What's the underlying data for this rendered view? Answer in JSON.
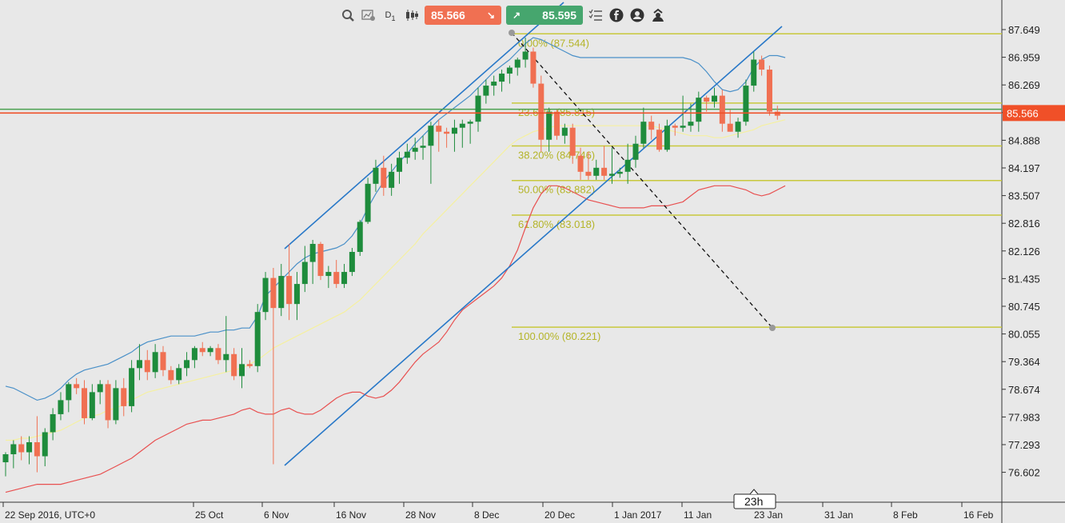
{
  "toolbar": {
    "timeframe": "D",
    "timeframe_sub": "1",
    "sell_price": "85.566",
    "buy_price": "85.595",
    "sell_color": "#f07052",
    "buy_color": "#46a66e",
    "icons": [
      "zoom-icon",
      "chart-settings-icon",
      "timeframe-icon",
      "candles-icon",
      "sell-arrow-icon",
      "buy-arrow-icon",
      "list-icon",
      "facebook-icon",
      "profile-icon",
      "user-icon"
    ]
  },
  "badge": {
    "time_left": "23h"
  },
  "chart_data": {
    "type": "candlestick",
    "instrument_price_now": 85.566,
    "ylim": [
      76.3,
      88.0
    ],
    "y_ticks": [
      "87.649",
      "86.959",
      "86.269",
      "85.566",
      "84.888",
      "84.197",
      "83.507",
      "82.816",
      "82.126",
      "81.435",
      "80.745",
      "80.055",
      "79.364",
      "78.674",
      "77.983",
      "77.293",
      "76.602"
    ],
    "x_ticks": [
      "22 Sep 2016, UTC+0",
      "25 Oct",
      "6 Nov",
      "16 Nov",
      "28 Nov",
      "8 Dec",
      "20 Dec",
      "1 Jan 2017",
      "11 Jan",
      "23 Jan",
      "31 Jan",
      "8 Feb",
      "16 Feb"
    ],
    "colors": {
      "up": "#1e8c3c",
      "down": "#f07052",
      "upper_band": "#4a90c8",
      "middle_band": "#f5f0a0",
      "lower_band": "#e85050",
      "trend": "#2878c8",
      "fib": "#c8c83c",
      "price_line": "#f05028",
      "hline": "#4aa050"
    },
    "candles": [
      {
        "o": 76.85,
        "h": 77.1,
        "l": 76.5,
        "c": 77.05
      },
      {
        "o": 77.05,
        "h": 77.4,
        "l": 76.7,
        "c": 77.3
      },
      {
        "o": 77.3,
        "h": 77.5,
        "l": 76.9,
        "c": 77.1
      },
      {
        "o": 77.1,
        "h": 77.5,
        "l": 76.8,
        "c": 77.35
      },
      {
        "o": 77.35,
        "h": 78.0,
        "l": 76.6,
        "c": 77.0
      },
      {
        "o": 77.0,
        "h": 77.7,
        "l": 76.75,
        "c": 77.6
      },
      {
        "o": 77.6,
        "h": 78.2,
        "l": 77.4,
        "c": 78.05
      },
      {
        "o": 78.05,
        "h": 78.6,
        "l": 77.9,
        "c": 78.4
      },
      {
        "o": 78.4,
        "h": 78.85,
        "l": 78.1,
        "c": 78.8
      },
      {
        "o": 78.8,
        "h": 78.95,
        "l": 78.55,
        "c": 78.7
      },
      {
        "o": 78.7,
        "h": 78.9,
        "l": 77.8,
        "c": 77.95
      },
      {
        "o": 77.95,
        "h": 78.8,
        "l": 77.9,
        "c": 78.6
      },
      {
        "o": 78.6,
        "h": 78.9,
        "l": 78.3,
        "c": 78.8
      },
      {
        "o": 78.8,
        "h": 78.9,
        "l": 77.7,
        "c": 77.9
      },
      {
        "o": 77.9,
        "h": 78.9,
        "l": 77.8,
        "c": 78.7
      },
      {
        "o": 78.7,
        "h": 78.95,
        "l": 78.0,
        "c": 78.25
      },
      {
        "o": 78.25,
        "h": 79.4,
        "l": 78.1,
        "c": 79.2
      },
      {
        "o": 79.2,
        "h": 79.8,
        "l": 78.9,
        "c": 79.4
      },
      {
        "o": 79.4,
        "h": 79.65,
        "l": 78.9,
        "c": 79.1
      },
      {
        "o": 79.1,
        "h": 79.8,
        "l": 78.95,
        "c": 79.6
      },
      {
        "o": 79.6,
        "h": 79.75,
        "l": 79.0,
        "c": 79.15
      },
      {
        "o": 79.15,
        "h": 79.25,
        "l": 78.8,
        "c": 78.9
      },
      {
        "o": 78.9,
        "h": 79.3,
        "l": 78.8,
        "c": 79.2
      },
      {
        "o": 79.2,
        "h": 79.6,
        "l": 79.0,
        "c": 79.4
      },
      {
        "o": 79.4,
        "h": 79.75,
        "l": 79.2,
        "c": 79.7
      },
      {
        "o": 79.7,
        "h": 79.85,
        "l": 79.5,
        "c": 79.6
      },
      {
        "o": 79.6,
        "h": 79.75,
        "l": 79.5,
        "c": 79.7
      },
      {
        "o": 79.7,
        "h": 79.8,
        "l": 79.3,
        "c": 79.4
      },
      {
        "o": 79.4,
        "h": 80.5,
        "l": 79.1,
        "c": 79.55
      },
      {
        "o": 79.55,
        "h": 79.7,
        "l": 78.9,
        "c": 79.0
      },
      {
        "o": 79.0,
        "h": 79.7,
        "l": 78.7,
        "c": 79.3
      },
      {
        "o": 79.3,
        "h": 79.4,
        "l": 79.2,
        "c": 79.25
      },
      {
        "o": 79.25,
        "h": 80.8,
        "l": 79.1,
        "c": 80.6
      },
      {
        "o": 80.6,
        "h": 81.6,
        "l": 80.4,
        "c": 81.45
      },
      {
        "o": 81.45,
        "h": 81.7,
        "l": 76.8,
        "c": 80.7
      },
      {
        "o": 80.7,
        "h": 81.8,
        "l": 80.5,
        "c": 81.5
      },
      {
        "o": 81.5,
        "h": 82.3,
        "l": 80.4,
        "c": 80.8
      },
      {
        "o": 80.8,
        "h": 81.6,
        "l": 80.4,
        "c": 81.3
      },
      {
        "o": 81.3,
        "h": 82.25,
        "l": 81.1,
        "c": 81.85
      },
      {
        "o": 81.85,
        "h": 82.4,
        "l": 81.3,
        "c": 82.3
      },
      {
        "o": 82.3,
        "h": 82.35,
        "l": 81.4,
        "c": 81.5
      },
      {
        "o": 81.5,
        "h": 81.75,
        "l": 81.2,
        "c": 81.6
      },
      {
        "o": 81.6,
        "h": 81.9,
        "l": 81.2,
        "c": 81.3
      },
      {
        "o": 81.3,
        "h": 81.8,
        "l": 81.2,
        "c": 81.6
      },
      {
        "o": 81.6,
        "h": 82.2,
        "l": 81.5,
        "c": 82.1
      },
      {
        "o": 82.1,
        "h": 82.9,
        "l": 82.0,
        "c": 82.85
      },
      {
        "o": 82.85,
        "h": 83.95,
        "l": 82.8,
        "c": 83.8
      },
      {
        "o": 83.8,
        "h": 84.4,
        "l": 83.6,
        "c": 84.2
      },
      {
        "o": 84.2,
        "h": 84.5,
        "l": 83.5,
        "c": 83.7
      },
      {
        "o": 83.7,
        "h": 84.3,
        "l": 83.5,
        "c": 84.1
      },
      {
        "o": 84.1,
        "h": 84.6,
        "l": 83.8,
        "c": 84.45
      },
      {
        "o": 84.45,
        "h": 84.8,
        "l": 84.3,
        "c": 84.6
      },
      {
        "o": 84.6,
        "h": 84.95,
        "l": 84.4,
        "c": 84.7
      },
      {
        "o": 84.7,
        "h": 85.0,
        "l": 84.4,
        "c": 84.75
      },
      {
        "o": 84.75,
        "h": 85.35,
        "l": 83.8,
        "c": 85.25
      },
      {
        "o": 85.25,
        "h": 85.4,
        "l": 84.6,
        "c": 85.1
      },
      {
        "o": 85.1,
        "h": 85.2,
        "l": 84.7,
        "c": 85.05
      },
      {
        "o": 85.05,
        "h": 85.4,
        "l": 84.6,
        "c": 85.2
      },
      {
        "o": 85.2,
        "h": 85.4,
        "l": 84.7,
        "c": 85.3
      },
      {
        "o": 85.3,
        "h": 85.4,
        "l": 84.8,
        "c": 85.35
      },
      {
        "o": 85.35,
        "h": 86.2,
        "l": 85.1,
        "c": 86.0
      },
      {
        "o": 86.0,
        "h": 86.4,
        "l": 85.8,
        "c": 86.25
      },
      {
        "o": 86.25,
        "h": 86.5,
        "l": 86.0,
        "c": 86.35
      },
      {
        "o": 86.35,
        "h": 86.65,
        "l": 86.1,
        "c": 86.55
      },
      {
        "o": 86.55,
        "h": 86.75,
        "l": 86.3,
        "c": 86.7
      },
      {
        "o": 86.7,
        "h": 86.95,
        "l": 86.5,
        "c": 86.9
      },
      {
        "o": 86.9,
        "h": 87.45,
        "l": 86.7,
        "c": 87.1
      },
      {
        "o": 87.1,
        "h": 87.2,
        "l": 86.2,
        "c": 86.3
      },
      {
        "o": 86.3,
        "h": 86.5,
        "l": 84.6,
        "c": 84.9
      },
      {
        "o": 84.9,
        "h": 85.7,
        "l": 84.6,
        "c": 85.6
      },
      {
        "o": 85.6,
        "h": 85.65,
        "l": 84.9,
        "c": 85.0
      },
      {
        "o": 85.0,
        "h": 85.3,
        "l": 84.8,
        "c": 85.2
      },
      {
        "o": 85.2,
        "h": 85.3,
        "l": 84.3,
        "c": 84.5
      },
      {
        "o": 84.5,
        "h": 84.7,
        "l": 83.9,
        "c": 84.1
      },
      {
        "o": 84.1,
        "h": 84.6,
        "l": 83.9,
        "c": 84.0
      },
      {
        "o": 84.0,
        "h": 84.4,
        "l": 83.9,
        "c": 84.2
      },
      {
        "o": 84.2,
        "h": 84.75,
        "l": 83.9,
        "c": 84.0
      },
      {
        "o": 84.0,
        "h": 84.7,
        "l": 83.8,
        "c": 84.05
      },
      {
        "o": 84.05,
        "h": 84.2,
        "l": 83.95,
        "c": 84.1
      },
      {
        "o": 84.1,
        "h": 84.8,
        "l": 83.8,
        "c": 84.4
      },
      {
        "o": 84.4,
        "h": 85.0,
        "l": 84.2,
        "c": 84.8
      },
      {
        "o": 84.8,
        "h": 85.7,
        "l": 84.7,
        "c": 85.35
      },
      {
        "o": 85.35,
        "h": 85.5,
        "l": 84.9,
        "c": 85.15
      },
      {
        "o": 85.15,
        "h": 85.3,
        "l": 84.6,
        "c": 84.65
      },
      {
        "o": 84.65,
        "h": 85.4,
        "l": 84.6,
        "c": 85.25
      },
      {
        "o": 85.25,
        "h": 85.3,
        "l": 85.0,
        "c": 85.2
      },
      {
        "o": 85.2,
        "h": 86.0,
        "l": 85.1,
        "c": 85.25
      },
      {
        "o": 85.25,
        "h": 85.8,
        "l": 85.1,
        "c": 85.35
      },
      {
        "o": 85.35,
        "h": 86.1,
        "l": 85.1,
        "c": 85.95
      },
      {
        "o": 85.95,
        "h": 86.0,
        "l": 85.6,
        "c": 85.85
      },
      {
        "o": 85.85,
        "h": 86.2,
        "l": 85.7,
        "c": 86.0
      },
      {
        "o": 86.0,
        "h": 86.15,
        "l": 85.1,
        "c": 85.3
      },
      {
        "o": 85.3,
        "h": 85.65,
        "l": 85.1,
        "c": 85.1
      },
      {
        "o": 85.1,
        "h": 85.45,
        "l": 84.95,
        "c": 85.35
      },
      {
        "o": 85.35,
        "h": 86.4,
        "l": 85.25,
        "c": 86.25
      },
      {
        "o": 86.25,
        "h": 87.1,
        "l": 86.1,
        "c": 86.9
      },
      {
        "o": 86.9,
        "h": 87.0,
        "l": 86.5,
        "c": 86.65
      },
      {
        "o": 86.65,
        "h": 86.75,
        "l": 85.5,
        "c": 85.6
      },
      {
        "o": 85.6,
        "h": 85.75,
        "l": 85.4,
        "c": 85.5
      }
    ],
    "bollinger": {
      "upper": [
        78.75,
        78.7,
        78.6,
        78.5,
        78.4,
        78.45,
        78.55,
        78.7,
        78.9,
        79.05,
        79.15,
        79.2,
        79.25,
        79.3,
        79.4,
        79.5,
        79.6,
        79.75,
        79.85,
        79.9,
        79.95,
        80.0,
        80.0,
        80.0,
        80.0,
        80.05,
        80.1,
        80.1,
        80.15,
        80.15,
        80.2,
        80.2,
        80.5,
        81.0,
        81.2,
        81.4,
        81.6,
        81.8,
        81.95,
        82.05,
        82.1,
        82.15,
        82.2,
        82.3,
        82.5,
        82.8,
        83.2,
        83.55,
        83.85,
        84.1,
        84.35,
        84.55,
        84.8,
        85.0,
        85.2,
        85.4,
        85.55,
        85.7,
        85.85,
        86.0,
        86.2,
        86.4,
        86.6,
        86.75,
        86.9,
        87.1,
        87.3,
        87.45,
        87.4,
        87.3,
        87.2,
        87.1,
        87.0,
        86.95,
        86.95,
        86.95,
        86.95,
        86.95,
        86.95,
        86.95,
        86.95,
        86.95,
        86.95,
        86.95,
        86.95,
        86.95,
        86.95,
        86.9,
        86.8,
        86.6,
        86.35,
        86.15,
        86.1,
        86.15,
        86.35,
        86.7,
        86.9,
        87.0,
        87.0,
        86.95
      ],
      "middle": [
        77.4,
        77.4,
        77.45,
        77.45,
        77.5,
        77.55,
        77.6,
        77.65,
        77.75,
        77.85,
        77.95,
        78.0,
        78.05,
        78.15,
        78.2,
        78.3,
        78.4,
        78.5,
        78.6,
        78.65,
        78.7,
        78.75,
        78.8,
        78.85,
        78.9,
        78.95,
        79.0,
        79.05,
        79.1,
        79.15,
        79.2,
        79.3,
        79.4,
        79.55,
        79.7,
        79.8,
        79.9,
        80.0,
        80.1,
        80.2,
        80.3,
        80.4,
        80.5,
        80.6,
        80.75,
        80.9,
        81.1,
        81.3,
        81.5,
        81.7,
        81.9,
        82.1,
        82.3,
        82.55,
        82.75,
        82.95,
        83.15,
        83.35,
        83.55,
        83.75,
        83.95,
        84.15,
        84.35,
        84.55,
        84.75,
        84.9,
        85.0,
        85.1,
        85.15,
        85.2,
        85.25,
        85.25,
        85.25,
        85.25,
        85.25,
        85.25,
        85.25,
        85.25,
        85.25,
        85.25,
        85.25,
        85.25,
        85.25,
        85.2,
        85.15,
        85.1,
        85.05,
        85.0,
        85.0,
        85.0,
        84.95,
        84.95,
        85.0,
        85.05,
        85.1,
        85.15,
        85.25,
        85.3,
        85.35,
        85.4
      ],
      "lower": [
        76.1,
        76.15,
        76.2,
        76.25,
        76.3,
        76.3,
        76.3,
        76.3,
        76.35,
        76.4,
        76.45,
        76.5,
        76.55,
        76.65,
        76.75,
        76.85,
        76.95,
        77.1,
        77.25,
        77.4,
        77.5,
        77.6,
        77.7,
        77.8,
        77.85,
        77.9,
        77.9,
        77.95,
        78.0,
        78.05,
        78.15,
        78.2,
        78.1,
        78.05,
        78.05,
        78.15,
        78.2,
        78.1,
        78.05,
        78.05,
        78.15,
        78.3,
        78.45,
        78.55,
        78.6,
        78.6,
        78.5,
        78.45,
        78.5,
        78.65,
        78.85,
        79.1,
        79.35,
        79.55,
        79.7,
        79.85,
        80.1,
        80.4,
        80.65,
        80.8,
        80.95,
        81.1,
        81.25,
        81.45,
        81.75,
        82.15,
        82.7,
        83.2,
        83.55,
        83.75,
        83.75,
        83.7,
        83.6,
        83.5,
        83.4,
        83.35,
        83.3,
        83.25,
        83.2,
        83.2,
        83.2,
        83.2,
        83.25,
        83.25,
        83.25,
        83.3,
        83.35,
        83.5,
        83.65,
        83.7,
        83.75,
        83.75,
        83.75,
        83.7,
        83.65,
        83.55,
        83.5,
        83.55,
        83.65,
        83.75
      ]
    },
    "fibonacci": {
      "levels": [
        {
          "label": "0.00% (87.544)",
          "value": 87.544
        },
        {
          "label": "23.60% (85.815)",
          "value": 85.815
        },
        {
          "label": "38.20% (84.746)",
          "value": 84.746
        },
        {
          "label": "50.00% (83.882)",
          "value": 83.882
        },
        {
          "label": "61.80% (83.018)",
          "value": 83.018
        },
        {
          "label": "100.00% (80.221)",
          "value": 80.221
        }
      ],
      "start_candle": 66,
      "end_candle": 119
    },
    "horizontal_lines": [
      85.6
    ],
    "current_price": 85.566,
    "current_price_label": "85.566"
  }
}
